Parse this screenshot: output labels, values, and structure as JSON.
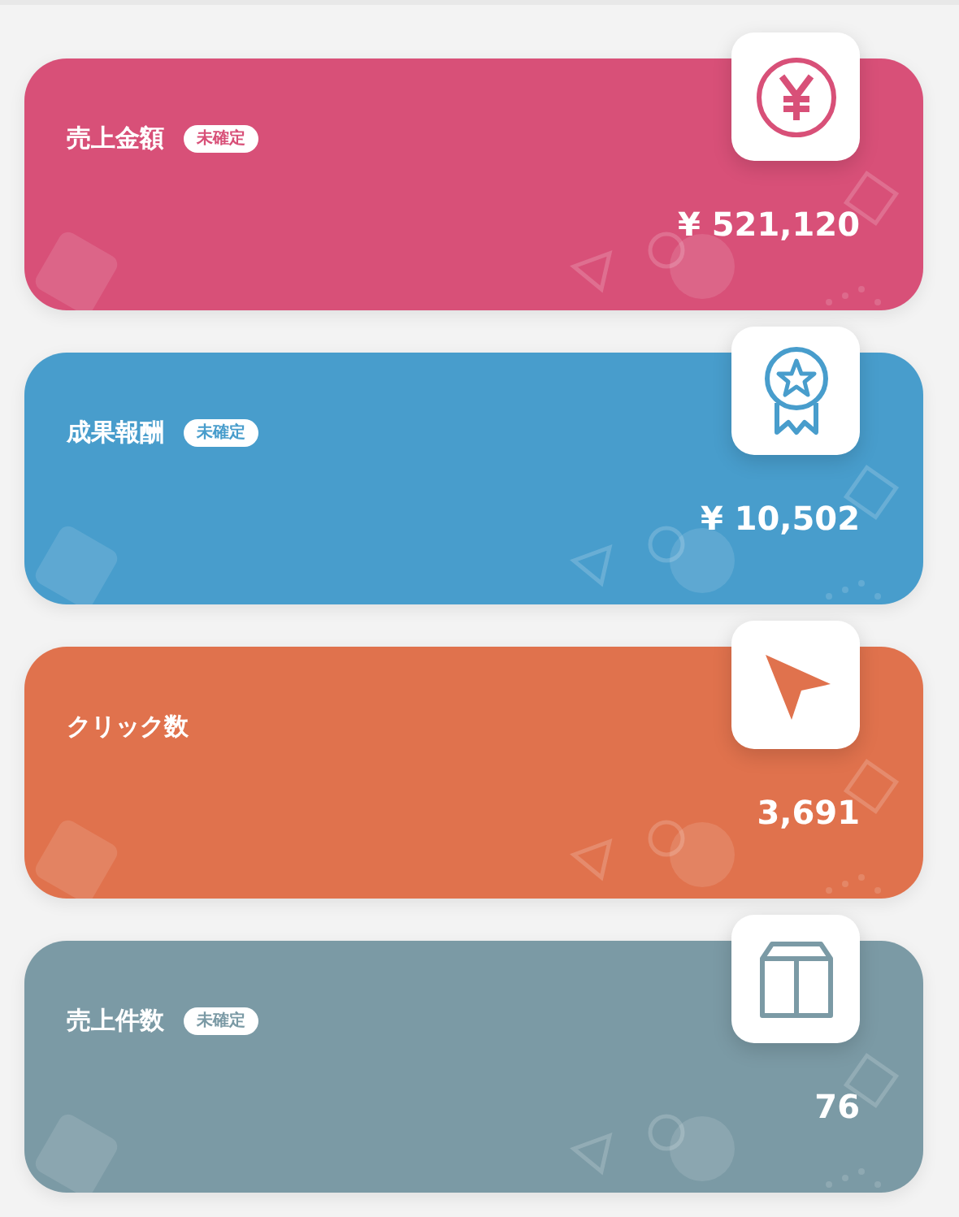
{
  "cards": [
    {
      "title": "売上金額",
      "badge": "未確定",
      "value": "¥ 521,120",
      "kind": "yen",
      "color": "#d85078"
    },
    {
      "title": "成果報酬",
      "badge": "未確定",
      "value": "¥ 10,502",
      "kind": "medal",
      "color": "#489dcc"
    },
    {
      "title": "クリック数",
      "value": "3,691",
      "kind": "cursor",
      "color": "#e0724d"
    },
    {
      "title": "売上件数",
      "badge": "未確定",
      "value": "76",
      "kind": "box",
      "color": "#7b9aa5"
    }
  ]
}
